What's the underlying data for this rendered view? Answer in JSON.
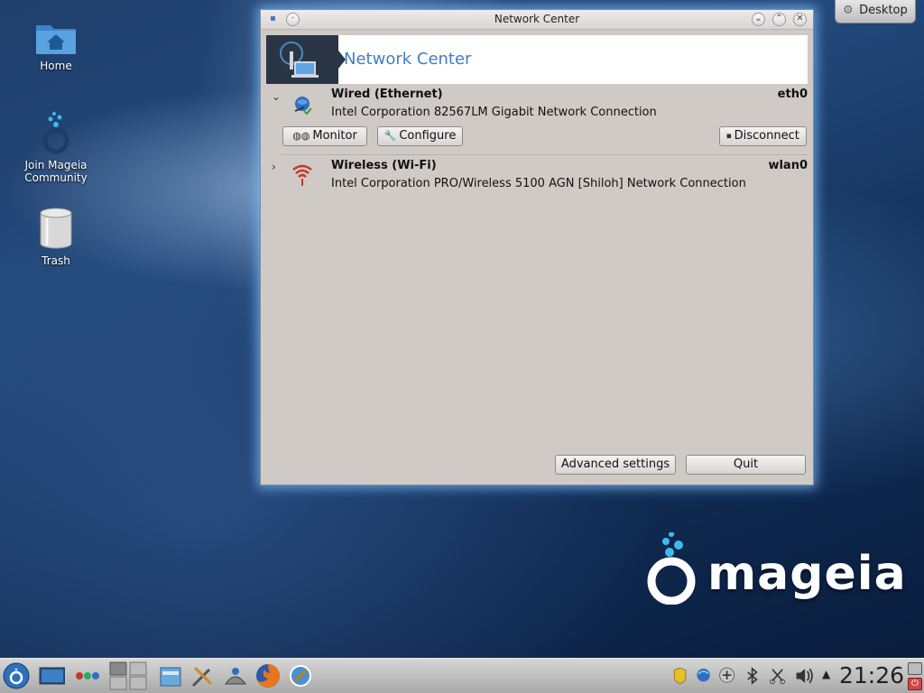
{
  "desktop": {
    "icons": [
      {
        "label": "Home"
      },
      {
        "label": "Join Mageia Community"
      },
      {
        "label": "Trash"
      }
    ],
    "cashew_label": "Desktop"
  },
  "window": {
    "title": "Network Center",
    "header_title": "Network Center",
    "connections": [
      {
        "name": "Wired (Ethernet)",
        "interface": "eth0",
        "description": "Intel Corporation 82567LM Gigabit Network Connection",
        "expanded": true,
        "icon": "wired-globe-icon",
        "buttons": {
          "monitor": "Monitor",
          "configure": "Configure",
          "disconnect": "Disconnect"
        }
      },
      {
        "name": "Wireless (Wi-Fi)",
        "interface": "wlan0",
        "description": "Intel Corporation PRO/Wireless 5100 AGN [Shiloh] Network Connection",
        "expanded": false,
        "icon": "wifi-signal-icon"
      }
    ],
    "footer": {
      "advanced_label": "Advanced settings",
      "quit_label": "Quit"
    }
  },
  "branding": {
    "logo_text": "mageia"
  },
  "taskbar": {
    "clock": "21:26",
    "launchers": [
      "mageia-menu-icon",
      "show-desktop-icon",
      "activity-dots-icon",
      "pager-icon",
      "file-manager-icon",
      "control-center-icon",
      "network-tool-icon",
      "firefox-icon",
      "network-center-icon"
    ],
    "tray": [
      "security-shield-icon",
      "network-globe-icon",
      "gamepad-icon",
      "bluetooth-icon",
      "clipboard-scissors-icon",
      "volume-icon",
      "tray-expand-icon"
    ]
  },
  "colors": {
    "accent": "#3f7fc2",
    "window_bg": "#cfcac6",
    "glow": "#78beff"
  }
}
